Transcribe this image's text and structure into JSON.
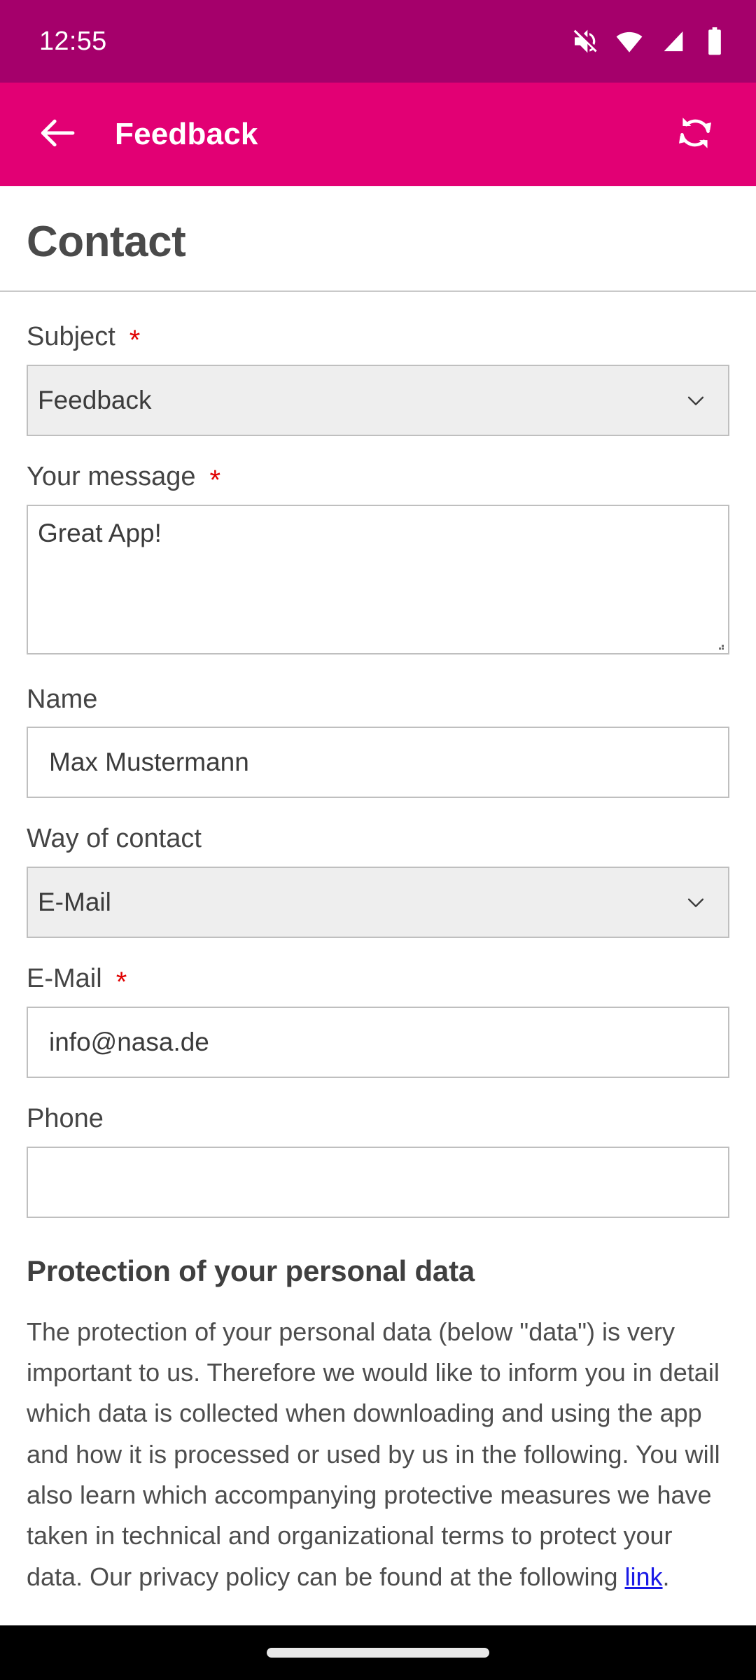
{
  "status_bar": {
    "time": "12:55",
    "icons": [
      "mute-icon",
      "wifi-icon",
      "cellular-signal-icon",
      "battery-icon"
    ],
    "background_color": "#A5006B"
  },
  "app_bar": {
    "back_icon": "arrow-left-icon",
    "title": "Feedback",
    "refresh_icon": "refresh-icon",
    "background_color": "#E20074"
  },
  "page": {
    "title": "Contact"
  },
  "form": {
    "subject": {
      "label": "Subject",
      "required_marker": "*",
      "value": "Feedback",
      "chevron_icon": "chevron-down-icon"
    },
    "message": {
      "label": "Your message",
      "required_marker": "*",
      "value": "Great App!"
    },
    "name": {
      "label": "Name",
      "value": "Max Mustermann"
    },
    "way_of_contact": {
      "label": "Way of contact",
      "value": "E-Mail",
      "chevron_icon": "chevron-down-icon"
    },
    "email": {
      "label": "E-Mail",
      "required_marker": "*",
      "value": "info@nasa.de"
    },
    "phone": {
      "label": "Phone",
      "value": ""
    }
  },
  "privacy": {
    "heading": "Protection of your personal data",
    "body_before_link": "The protection of your personal data (below \"data\") is very important to us. Therefore we would like to inform you in detail which data is collected when downloading and using the app and how it is processed or used by us in the following. You will also learn which accompanying protective measures we have taken in technical and organizational terms to protect your data. Our privacy policy can be found at the following ",
    "link_text": "link",
    "body_after_link": ".",
    "link_color": "#1a1ae6"
  },
  "nav_bar": {
    "gesture_pill": "home-indicator"
  }
}
